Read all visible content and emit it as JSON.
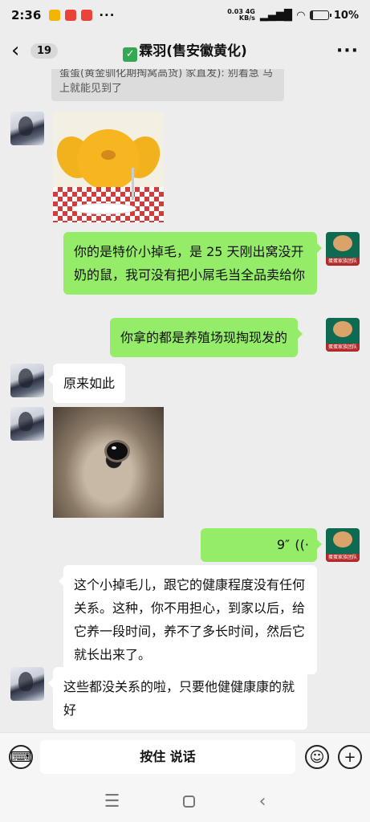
{
  "status_bar": {
    "time": "2:36",
    "net_speed_value": "0.03",
    "net_speed_unit": "KB/s",
    "network": "4G",
    "battery": "10%",
    "mini_icons": [
      "#f5b400",
      "#e8443a",
      "#e8443a"
    ]
  },
  "header": {
    "back_count": "19",
    "title": "霖羽(售安徽黄化)",
    "more": "···"
  },
  "messages": [
    {
      "type": "quote",
      "text": "蛋蛋(黄金驯化期掏窝高货) 家直发): 别着急 马上就能见到了"
    },
    {
      "type": "sticker",
      "side": "left",
      "avatar": "girl-avatar"
    },
    {
      "type": "text",
      "side": "right",
      "text": "你的是特价小掉毛，是 25 天刚出窝没开奶的鼠，我可没有把小屌毛当全品卖给你"
    },
    {
      "type": "text",
      "side": "right",
      "text": "你拿的都是养殖场现掏现发的"
    },
    {
      "type": "text",
      "side": "left",
      "text": "原来如此"
    },
    {
      "type": "image",
      "side": "left",
      "image": "kitten-photo"
    },
    {
      "type": "voice",
      "side": "right",
      "duration": "9″"
    },
    {
      "type": "text",
      "side": "left",
      "text": "这个小掉毛儿，跟它的健康程度没有任何关系。这种，你不用担心，到家以后，给它养一段时间，养不了多长时间，然后它就长出来了。"
    },
    {
      "type": "text",
      "side": "left",
      "text": "这些都没关系的啦，只要他健健康康的就好"
    }
  ],
  "avatar_label": "蛋蛋家族团队",
  "input_bar": {
    "hold_to_talk": "按住 说话",
    "keyboard_icon": "keyboard-icon",
    "emoji_icon": "emoji-icon",
    "plus_icon": "plus-icon"
  },
  "nav": {
    "menu": "☰",
    "back": "‹"
  },
  "colors": {
    "background": "#ededed",
    "green_bubble": "#95ec69",
    "white_bubble": "#ffffff"
  }
}
